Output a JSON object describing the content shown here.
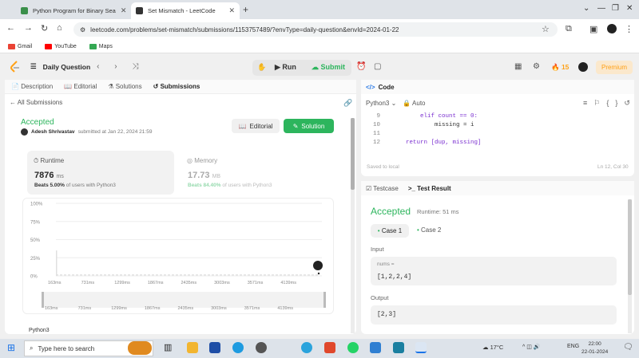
{
  "browser": {
    "tabs": [
      {
        "title": "Python Program for Binary Sea",
        "active": false
      },
      {
        "title": "Set Mismatch - LeetCode",
        "active": true
      }
    ],
    "url": "leetcode.com/problems/set-mismatch/submissions/1153757489/?envType=daily-question&envId=2024-01-22",
    "bookmarks": [
      "Gmail",
      "YouTube",
      "Maps"
    ]
  },
  "nav": {
    "title": "Daily Question",
    "run_label": "Run",
    "submit_label": "Submit",
    "streak": "15",
    "premium_label": "Premium"
  },
  "left": {
    "tabs": [
      "Description",
      "Editorial",
      "Solutions",
      "Submissions"
    ],
    "back_label": "All Submissions",
    "status": "Accepted",
    "author": "Adesh Shrivastav",
    "submitted": "submitted at Jan 22, 2024 21:59",
    "editorial_btn": "Editorial",
    "solution_btn": "Solution",
    "runtime_label": "Runtime",
    "runtime_value": "7876",
    "runtime_unit": "ms",
    "runtime_beats_pre": "Beats 5.00%",
    "runtime_beats_post": "of users with Python3",
    "memory_label": "Memory",
    "memory_value": "17.73",
    "memory_unit": "MB",
    "memory_beats_pre": "Beats 84.40%",
    "memory_beats_post": "of users with Python3",
    "language": "Python3"
  },
  "chart_data": {
    "type": "bar",
    "y_ticks": [
      "100%",
      "75%",
      "50%",
      "25%",
      "0%"
    ],
    "x_ticks": [
      "163ms",
      "731ms",
      "1299ms",
      "1867ms",
      "2435ms",
      "3003ms",
      "3571ms",
      "4139ms"
    ],
    "ylim": [
      0,
      100
    ],
    "spike_at": "163ms",
    "spike_value": 35,
    "user_runtime": "7876ms"
  },
  "code": {
    "header": "Code",
    "language": "Python3",
    "mode": "Auto",
    "lines": [
      {
        "n": "9",
        "text": "        elif count == 0:"
      },
      {
        "n": "10",
        "text": "            missing = i"
      },
      {
        "n": "11",
        "text": ""
      },
      {
        "n": "12",
        "text": "    return [dup, missing]"
      }
    ],
    "saved": "Saved to local",
    "position": "Ln 12, Col 30"
  },
  "test": {
    "tab1": "Testcase",
    "tab2": "Test Result",
    "status": "Accepted",
    "runtime": "Runtime: 51 ms",
    "case1": "Case 1",
    "case2": "Case 2",
    "input_label": "Input",
    "input_var": "nums =",
    "input_value": "[1,2,2,4]",
    "output_label": "Output",
    "output_value": "[2,3]"
  },
  "taskbar": {
    "search_placeholder": "Type here to search",
    "temperature": "17°C",
    "lang": "ENG",
    "time": "22:00",
    "date": "22-01-2024"
  }
}
